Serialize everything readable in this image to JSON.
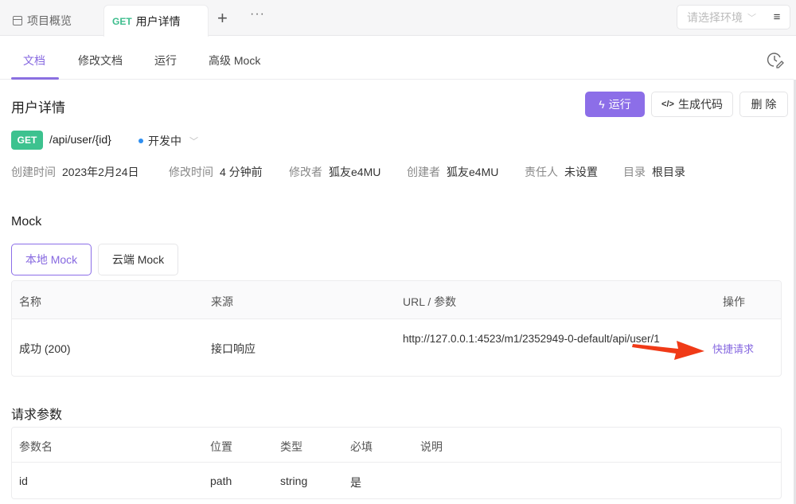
{
  "topbar": {
    "tabs": [
      {
        "label": "项目概览",
        "icon": "layout-icon"
      },
      {
        "method": "GET",
        "label": "用户详情"
      }
    ],
    "add": "+",
    "more": "···",
    "env_placeholder": "请选择环境",
    "menu": "≡"
  },
  "subtabs": [
    "文档",
    "修改文档",
    "运行",
    "高级 Mock"
  ],
  "title": "用户详情",
  "actions": {
    "run": "运行",
    "code": "生成代码",
    "delete": "删 除"
  },
  "endpoint": {
    "method": "GET",
    "path": "/api/user/{id}",
    "status": "开发中"
  },
  "meta": [
    {
      "k": "创建时间",
      "v": "2023年2月24日"
    },
    {
      "k": "修改时间",
      "v": "4 分钟前"
    },
    {
      "k": "修改者",
      "v": "狐友e4MU"
    },
    {
      "k": "创建者",
      "v": "狐友e4MU"
    },
    {
      "k": "责任人",
      "v": "未设置"
    },
    {
      "k": "目录",
      "v": "根目录"
    }
  ],
  "mock": {
    "heading": "Mock",
    "tabs": [
      "本地 Mock",
      "云端 Mock"
    ],
    "columns": [
      "名称",
      "来源",
      "URL / 参数",
      "操作"
    ],
    "rows": [
      {
        "name": "成功 (200)",
        "source": "接口响应",
        "url": "http://127.0.0.1:4523/m1/2352949-0-default/api/user/1",
        "action": "快捷请求"
      }
    ]
  },
  "params": {
    "heading": "请求参数",
    "columns": [
      "参数名",
      "位置",
      "类型",
      "必填",
      "说明"
    ],
    "rows": [
      {
        "name": "id",
        "position": "path",
        "type": "string",
        "required": "是",
        "desc": ""
      }
    ]
  },
  "colors": {
    "accent": "#8c6ee8",
    "get": "#3dc28f",
    "arrow": "#f03a17"
  }
}
